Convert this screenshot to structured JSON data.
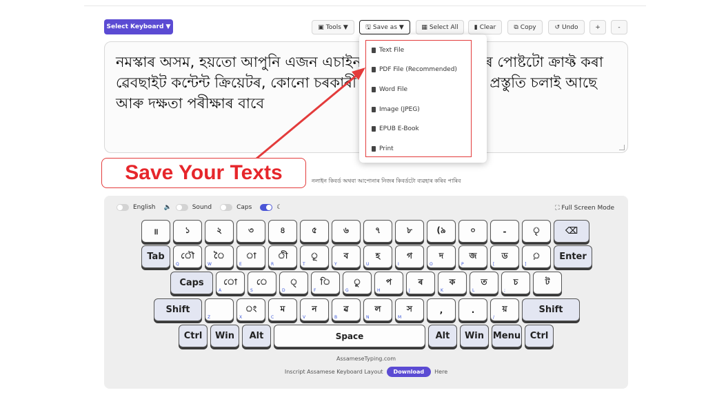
{
  "toolbar": {
    "select_keyboard": "Select Keyboard ▼",
    "tools": "Tools ▼",
    "save_as": "Save as ▼",
    "select_all": "Select All",
    "clear": "Clear",
    "copy": "Copy",
    "undo": "Undo",
    "plus": "+",
    "minus": "-"
  },
  "editor": {
    "text": "নমস্কাৰ অসম, হয়তো আপুনি এজন এচাইনমেন্ট লিখক, আপোনাৰ পোষ্টটো ক্ৰাফ্ট কৰা ৱেবছাইট কন্টেন্ট ক্ৰিয়েটৰ, কোনো চৰকাৰী চাকৰিৰ পৰীক্ষাৰ বাবে প্ৰস্তুতি চলাই আছে আৰু দক্ষতা পৰীক্ষাৰ বাবে"
  },
  "save_menu": {
    "items": [
      "Text File",
      "PDF File (Recommended)",
      "Word File",
      "Image (JPEG)",
      "EPUB E-Book",
      "Print"
    ]
  },
  "annotation": {
    "label": "Save Your Texts",
    "color": "#e6262b"
  },
  "hint_text": "নলাইন কিবৰ্ড অথবা আপোনাৰ নিজৰ কিবৰ্ডটো ব্যৱহাৰ কৰিব পাৰিব",
  "keyboard_options": {
    "english": "English",
    "sound": "Sound",
    "caps": "Caps",
    "fullscreen": "Full Screen Mode"
  },
  "keys": {
    "row1": [
      "॥",
      "১",
      "২",
      "৩",
      "৪",
      "৫",
      "৬",
      "৭",
      "৮",
      "(৯",
      "০",
      "-",
      "ৃ",
      "⌫"
    ],
    "row2": [
      "Tab",
      "ৌ",
      "ৈ",
      "া",
      "ী",
      "ূ",
      "ব",
      "হ",
      "গ",
      "দ",
      "জ",
      "ড",
      "়",
      "Enter"
    ],
    "row3": [
      "Caps",
      "ো",
      "ে",
      "্",
      "ি",
      "ু",
      "প",
      "ৰ",
      "ক",
      "ত",
      "চ",
      "ট"
    ],
    "row4": [
      "Shift",
      "",
      "ং",
      "ম",
      "ন",
      "ৱ",
      "ল",
      "স",
      ",",
      ".",
      "য়",
      "Shift"
    ],
    "row5": [
      "Ctrl",
      "Win",
      "Alt",
      "Space",
      "Alt",
      "Win",
      "Menu",
      "Ctrl"
    ]
  },
  "footer": {
    "site": "AssameseTyping.com",
    "layout_text": "Inscript Assamese Keyboard Layout",
    "download": "Download",
    "here": "Here"
  },
  "colors": {
    "accent": "#5b4bd3",
    "annotation_red": "#e33b3b"
  }
}
